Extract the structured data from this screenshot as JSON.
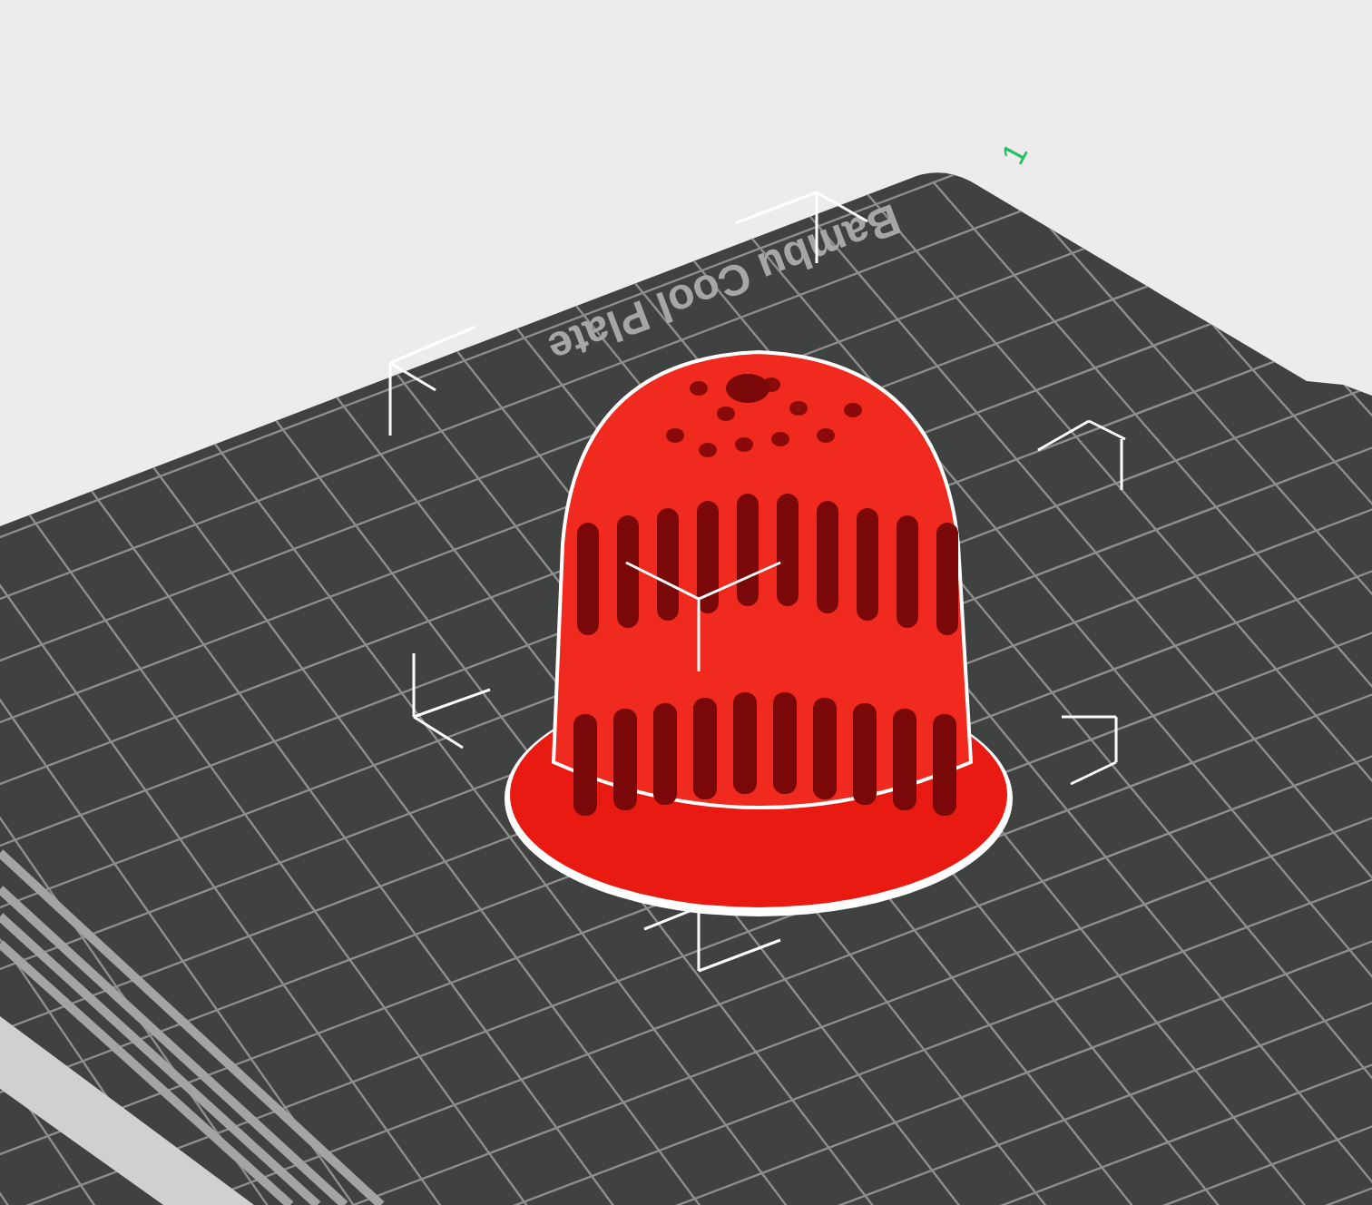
{
  "viewport": {
    "plate": {
      "label": "Bambu Cool Plate",
      "number": "1"
    },
    "model": {
      "selected": true
    }
  }
}
